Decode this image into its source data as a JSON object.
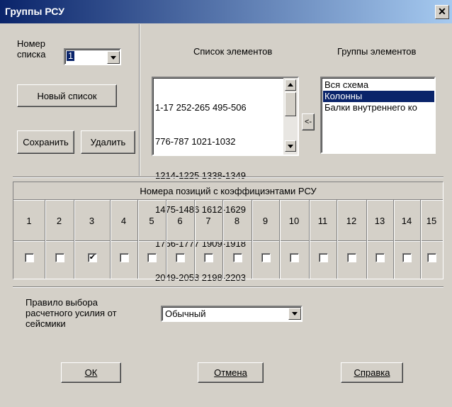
{
  "window": {
    "title": "Группы РСУ",
    "close": "✕"
  },
  "top_left": {
    "list_number_label_1": "Номер",
    "list_number_label_2": "списка",
    "list_number_value": "1",
    "new_list": "Новый список",
    "save": "Сохранить",
    "delete": "Удалить"
  },
  "elements": {
    "header": "Список элементов",
    "lines": [
      "1-17 252-265 495-506",
      "776-787 1021-1032",
      "1214-1225 1338-1349",
      "1475-1486 1612-1629",
      "1766-1777 1909-1918",
      "2049-2058 2198-2203"
    ],
    "arrow_button": "<-"
  },
  "groups": {
    "header": "Группы элементов",
    "items": [
      "Вся схема",
      "Колонны",
      "Балки внутреннего ко"
    ],
    "selected_index": 1
  },
  "positions": {
    "header": "Номера позиций с коэффициэнтами РСУ",
    "numbers": [
      "1",
      "2",
      "3",
      "4",
      "5",
      "6",
      "7",
      "8",
      "9",
      "10",
      "11",
      "12",
      "13",
      "14",
      "15"
    ],
    "checked": [
      false,
      false,
      true,
      false,
      false,
      false,
      false,
      false,
      false,
      false,
      false,
      false,
      false,
      false,
      false
    ],
    "check_mark": "✔"
  },
  "seismic": {
    "label_1": "Правило выбора",
    "label_2": "расчетного усилия от",
    "label_3": "сейсмики",
    "value": "Обычный"
  },
  "buttons": {
    "ok": "ОК",
    "cancel": "Отмена",
    "help": "Справка"
  }
}
